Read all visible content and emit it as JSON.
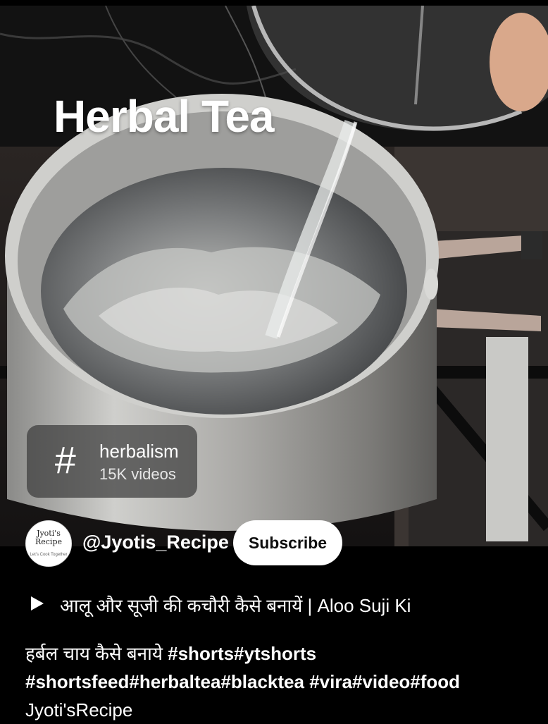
{
  "video": {
    "overlay_title": "Herbal Tea"
  },
  "hashtag_chip": {
    "symbol": "#",
    "name": "herbalism",
    "count": "15K videos"
  },
  "channel": {
    "avatar_text_line1": "Jyoti's",
    "avatar_text_line2": "Recipe",
    "avatar_tagline": "Let's Cook Together",
    "handle": "@Jyotis_Recipe",
    "subscribe_label": "Subscribe"
  },
  "playlist": {
    "title": "आलू और सूजी की कचौरी कैसे बनायें  | Aloo Suji Ki"
  },
  "description": {
    "line1_text": "हर्बल चाय कैसे बनाये ",
    "line1_tags": "#shorts#ytshorts",
    "line2": "#shortsfeed#herbaltea#blacktea  #vira#video#food",
    "line3": "Jyoti'sRecipe"
  },
  "colors": {
    "background": "#000000",
    "subscribe_bg": "#ffffff",
    "chip_bg": "#3c3c3c"
  },
  "icons": {
    "play": "play-icon",
    "hashtag": "hashtag-icon"
  }
}
